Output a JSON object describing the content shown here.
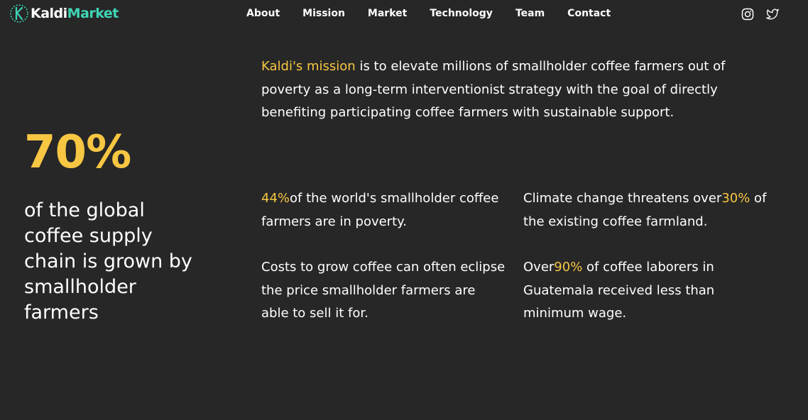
{
  "nav": {
    "logo": {
      "part1": "Kaldi",
      "part2": "Market"
    },
    "items": [
      "About",
      "Mission",
      "Market",
      "Technology",
      "Team",
      "Contact"
    ],
    "social": [
      "instagram-icon",
      "twitter-icon"
    ]
  },
  "hero": {
    "stat": "70%",
    "text": "of the global coffee supply chain is grown by smallholder farmers"
  },
  "mission": {
    "highlight": "Kaldi's mission",
    "text": " is to elevate millions of smallholder coffee farmers out of poverty as a long-term interventionist strategy with the goal of directly benefiting participating coffee farmers with sustainable support."
  },
  "facts": [
    {
      "before": "",
      "highlight": "44%",
      "after": "of the world's smallholder coffee farmers are in poverty."
    },
    {
      "before": "Climate change threatens over",
      "highlight": "30%",
      "after": " of the existing coffee farmland."
    },
    {
      "before": "Costs to grow coffee can often eclipse the price smallholder farmers are able to sell it for.",
      "highlight": "",
      "after": ""
    },
    {
      "before": "Over",
      "highlight": "90%",
      "after": " of coffee laborers in Guatemala received less than minimum wage."
    }
  ],
  "colors": {
    "accent": "#f7c642",
    "brand": "#3fd6b5",
    "background": "#272727"
  }
}
